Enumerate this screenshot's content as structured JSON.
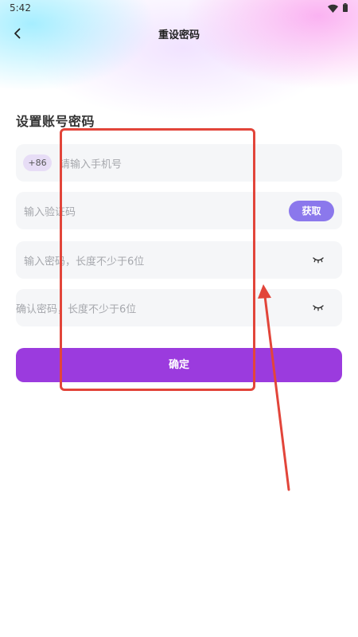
{
  "status_bar": {
    "time": "5:42"
  },
  "nav": {
    "back_icon": "chevron-left-icon",
    "title": "重设密码"
  },
  "form": {
    "section_title": "设置账号密码",
    "phone": {
      "country_code": "+86",
      "placeholder": "请输入手机号"
    },
    "code": {
      "placeholder": "输入验证码",
      "get_code_label": "获取"
    },
    "password": {
      "placeholder": "输入密码，长度不少于6位",
      "toggle_icon": "eye-closed-icon"
    },
    "confirm_password": {
      "placeholder": "确认密码，长度不少于6位",
      "toggle_icon": "eye-closed-icon"
    },
    "submit_label": "确定"
  },
  "colors": {
    "accent": "#9b3bde",
    "get_code_button": "#8b78ec",
    "field_background": "#f5f6f8",
    "annotation": "#e2453a"
  }
}
